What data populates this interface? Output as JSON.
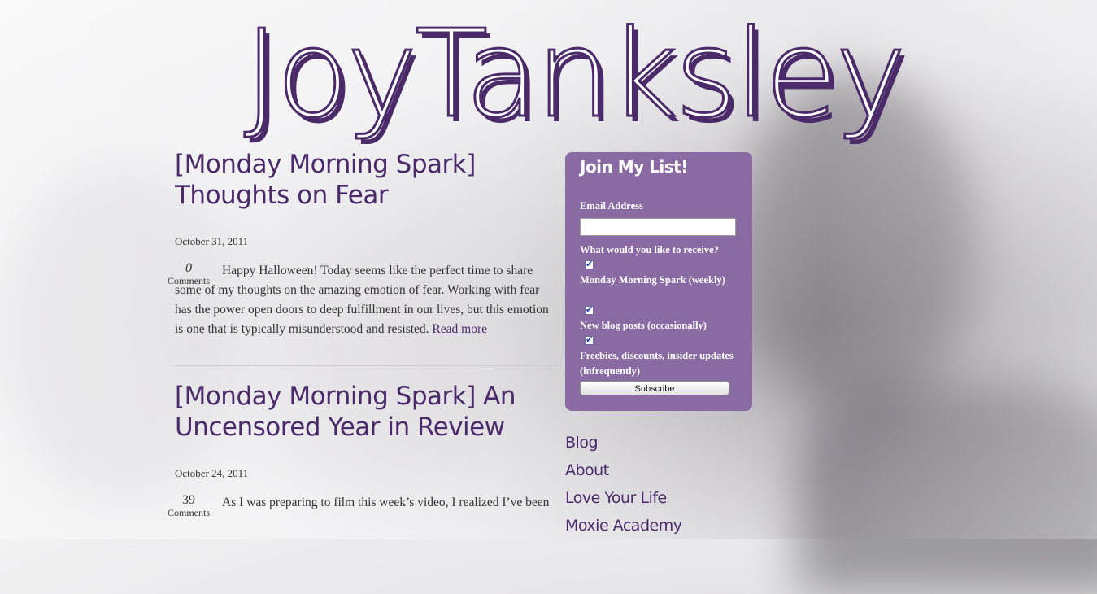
{
  "site": {
    "title": "JoyTanksley"
  },
  "posts": [
    {
      "title": "[Monday Morning Spark] Thoughts on Fear",
      "date": "October 31, 2011",
      "comments_count": "0",
      "comments_label": "Comments",
      "excerpt": "Happy Halloween! Today seems like the perfect time to share some of my thoughts on the amazing emotion of fear. Working with fear has the power open doors to deep fulfillment in our lives, but this emotion is one that is typically misunderstood and resisted.",
      "read_more": "Read more"
    },
    {
      "title": "[Monday Morning Spark] An Uncensored Year in Review",
      "date": "October 24, 2011",
      "comments_count": "39",
      "comments_label": "Comments",
      "excerpt": "As I was preparing to film this week’s video, I realized I’ve been"
    }
  ],
  "signup": {
    "heading": "Join My List!",
    "email_label": "Email Address",
    "email_value": "",
    "receive_label": "What would you like to receive?",
    "options": [
      {
        "label": "Monday Morning Spark (weekly)",
        "checked": true
      },
      {
        "label": "New blog posts (occasionally)",
        "checked": true
      },
      {
        "label": "Freebies, discounts, insider updates (infrequently)",
        "checked": true
      }
    ],
    "subscribe_label": "Subscribe"
  },
  "nav": [
    "Blog",
    "About",
    "Love Your Life",
    "Moxie Academy"
  ],
  "colors": {
    "brand_purple": "#4b2a6a",
    "signup_bg": "#8a6aa3"
  }
}
